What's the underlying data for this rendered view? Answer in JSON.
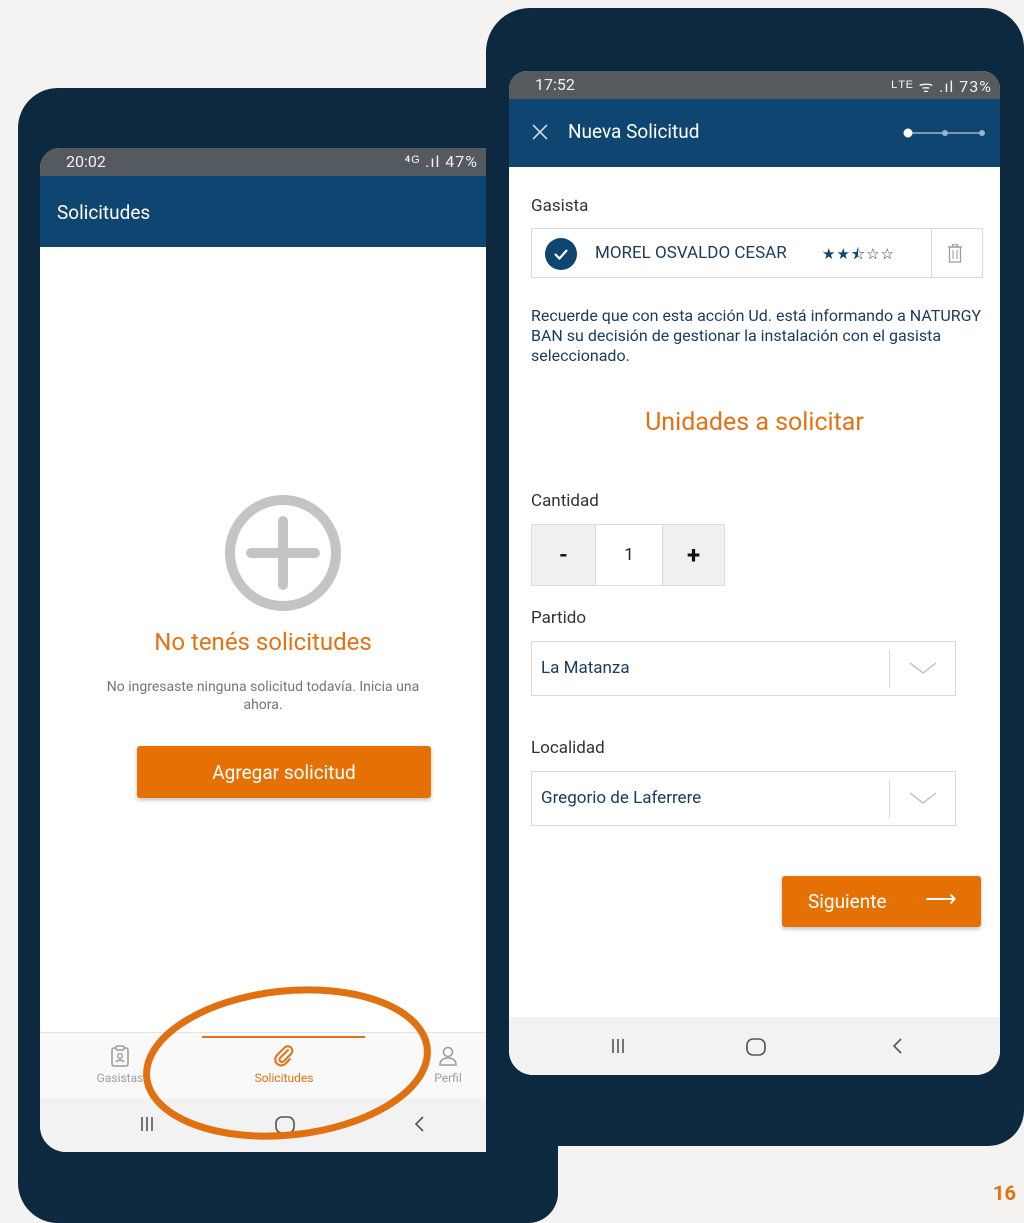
{
  "left_phone": {
    "status": {
      "time": "20:02",
      "icons": "⁴ᴳ .ıl 47%"
    },
    "app_title": "Solicitudes",
    "empty_title": "No tenés solicitudes",
    "empty_text": "No ingresaste ninguna solicitud todavía. Inicia una ahora.",
    "add_button": "Agregar solicitud",
    "nav": [
      {
        "label": "Gasistas",
        "icon": "clipboard-id-icon"
      },
      {
        "label": "Solicitudes",
        "icon": "paperclip-icon",
        "active": true
      },
      {
        "label": "Perfil",
        "icon": "user-icon"
      }
    ]
  },
  "right_phone": {
    "status": {
      "time": "17:52",
      "icons": "ᴸᵀᴱ ᯤ .ıl 73%"
    },
    "app_title": "Nueva Solicitud",
    "stepper": {
      "current_step": 1,
      "total_steps": 3
    },
    "gasista": {
      "label": "Gasista",
      "name": "MOREL OSVALDO CESAR",
      "rating": 2.5,
      "rating_max": 5,
      "stars_text": "★★⯪☆☆"
    },
    "info_text": "Recuerde que con esta acción Ud. está informando a NATURGY BAN su decisión de gestionar la instalación con el gasista seleccionado.",
    "section_title": "Unidades a solicitar",
    "cantidad": {
      "label": "Cantidad",
      "minus": "-",
      "value": "1",
      "plus": "+"
    },
    "partido": {
      "label": "Partido",
      "value": "La Matanza"
    },
    "localidad": {
      "label": "Localidad",
      "value": "Gregorio de Laferrere"
    },
    "next_button": {
      "label": "Siguiente",
      "arrow": "⟶"
    }
  },
  "page_number": "16",
  "colors": {
    "brand_blue": "#0e4571",
    "accent_orange": "#e57105",
    "frame": "#0c2940"
  }
}
